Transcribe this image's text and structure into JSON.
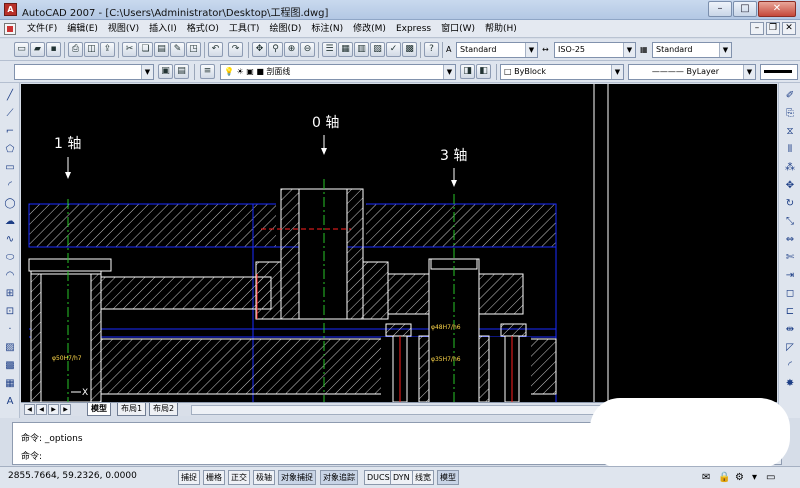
{
  "window": {
    "title": "AutoCAD 2007 - [C:\\Users\\Administrator\\Desktop\\工程图.dwg]",
    "app_icon": "autocad-logo-icon"
  },
  "menu": [
    "文件(F)",
    "编辑(E)",
    "视图(V)",
    "插入(I)",
    "格式(O)",
    "工具(T)",
    "绘图(D)",
    "标注(N)",
    "修改(M)",
    "Express",
    "窗口(W)",
    "帮助(H)"
  ],
  "toolbar": {
    "text_style": "Standard",
    "dim_style": "ISO-25",
    "table_style": "Standard",
    "layer": "剖面线",
    "color": "ByBlock",
    "linetype": "ByLayer"
  },
  "drawing": {
    "labels": [
      {
        "id": "axis-1",
        "text": "1  轴"
      },
      {
        "id": "axis-0",
        "text": "0  轴"
      },
      {
        "id": "axis-3",
        "text": "3  轴"
      }
    ],
    "dims": [
      "φ50H7/h7",
      "φ48H7/h6",
      "φ35H7/h6"
    ],
    "ucs_x": "X",
    "colors": {
      "background": "#000000",
      "outline": "#ffffff",
      "boundary": "#1a2cff",
      "centerline": "#27c427",
      "red": "#ff2020",
      "hatch": "#c8c8c8"
    }
  },
  "tabs": {
    "model": "模型",
    "layout1": "布局1",
    "layout2": "布局2"
  },
  "command": {
    "line1": "命令: _options",
    "line2": "命令:"
  },
  "status": {
    "coords": "2855.7664, 59.2326, 0.0000",
    "buttons": [
      "捕捉",
      "栅格",
      "正交",
      "极轴",
      "对象捕捉",
      "对象追踪",
      "DUCS",
      "DYN",
      "线宽",
      "模型"
    ]
  }
}
